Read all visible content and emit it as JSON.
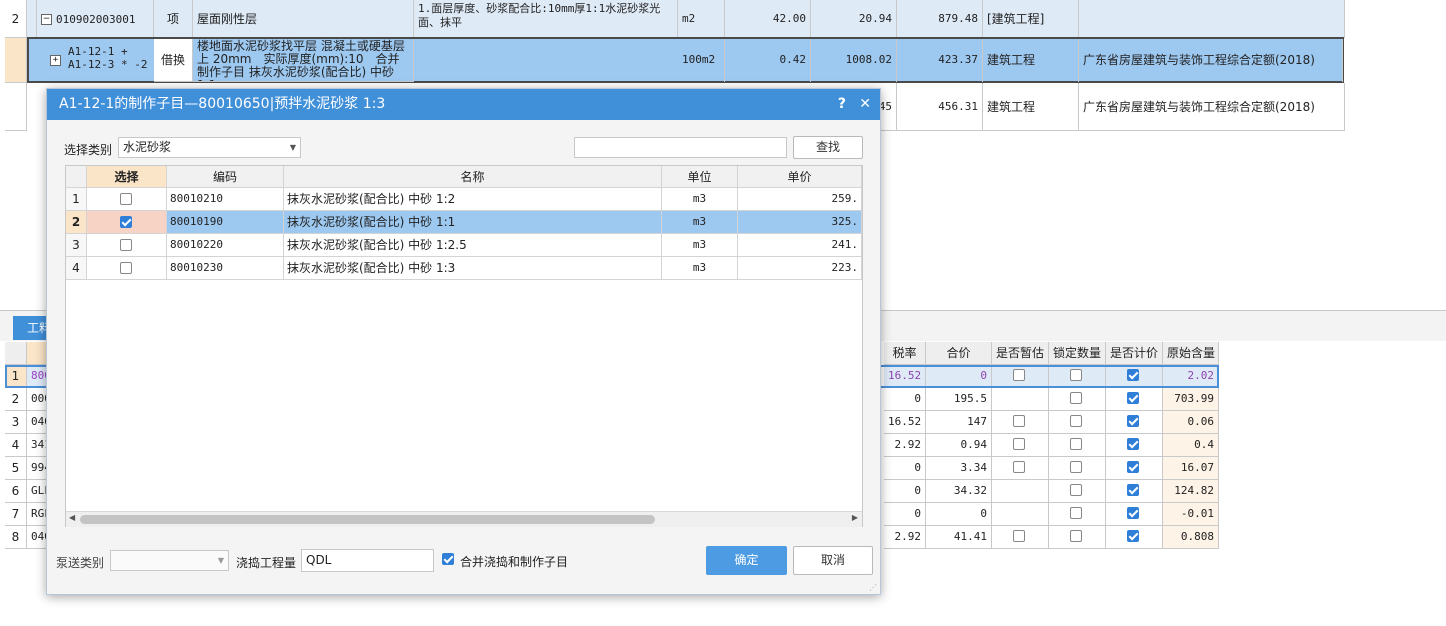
{
  "top_grid": {
    "rows": [
      {
        "index": "2",
        "code": "010902003001",
        "type": "项",
        "name": "屋面刚性层",
        "feature": "1.面层厚度、砂浆配合比:10mm厚1:1水泥砂浆光面、抹平",
        "unit": "m2",
        "qty": "42.00",
        "price": "20.94",
        "total": "879.48",
        "category": "[建筑工程]",
        "standard": ""
      },
      {
        "code_line1": "A1-12-1 +",
        "code_line2": "A1-12-3 * -2",
        "type": "借换",
        "name": "楼地面水泥砂浆找平层 混凝土或硬基层上 20mm　实际厚度(mm):10　合并制作子目 抹灰水泥砂浆(配合比) 中砂 1:1",
        "unit": "100m2",
        "qty": "0.42",
        "price": "1008.02",
        "total": "423.37",
        "category": "建筑工程",
        "standard": "广东省房屋建筑与装饰工程综合定额(2018)"
      },
      {
        "price_tail": "45",
        "total": "456.31",
        "category": "建筑工程",
        "standard": "广东省房屋建筑与装饰工程综合定额(2018)"
      }
    ]
  },
  "bottom_grid": {
    "tab_label": "工料",
    "headers": [
      "税率",
      "合价",
      "是否暂估",
      "锁定数量",
      "是否计价",
      "原始含量"
    ],
    "rows": [
      {
        "index": "1",
        "code": "800",
        "tax": "16.52",
        "total": "0",
        "est": "off",
        "lock": "off",
        "priced": "on",
        "orig": "2.02"
      },
      {
        "index": "2",
        "code": "000",
        "tax": "0",
        "total": "195.5",
        "est": "none",
        "lock": "off",
        "priced": "on",
        "orig": "703.99"
      },
      {
        "index": "3",
        "code": "040",
        "tax": "16.52",
        "total": "147",
        "est": "off",
        "lock": "off",
        "priced": "on",
        "orig": "0.06"
      },
      {
        "index": "4",
        "code": "341",
        "tax": "2.92",
        "total": "0.94",
        "est": "off",
        "lock": "off",
        "priced": "on",
        "orig": "0.4"
      },
      {
        "index": "5",
        "code": "994",
        "tax": "0",
        "total": "3.34",
        "est": "off",
        "lock": "off",
        "priced": "on",
        "orig": "16.07"
      },
      {
        "index": "6",
        "code": "GLF",
        "tax": "0",
        "total": "34.32",
        "est": "none",
        "lock": "off",
        "priced": "on",
        "orig": "124.82"
      },
      {
        "index": "7",
        "code": "RGF",
        "tax": "0",
        "total": "0",
        "est": "none",
        "lock": "off",
        "priced": "on",
        "orig": "-0.01"
      },
      {
        "index": "8",
        "code": "040",
        "tax": "2.92",
        "total": "41.41",
        "est": "off",
        "lock": "off",
        "priced": "on",
        "orig": "0.808"
      }
    ]
  },
  "dialog": {
    "title": "A1-12-1的制作子目—80010650|预拌水泥砂浆 1:3",
    "help_label": "?",
    "close_label": "✕",
    "category_label": "选择类别",
    "category_value": "水泥砂浆",
    "search_value": "",
    "find_label": "查找",
    "headers": {
      "select": "选择",
      "code": "编码",
      "name": "名称",
      "unit": "单位",
      "price": "单价"
    },
    "rows": [
      {
        "index": "1",
        "checked": false,
        "code": "80010210",
        "name": "抹灰水泥砂浆(配合比) 中砂 1:2",
        "unit": "m3",
        "price": "259."
      },
      {
        "index": "2",
        "checked": true,
        "code": "80010190",
        "name": "抹灰水泥砂浆(配合比) 中砂 1:1",
        "unit": "m3",
        "price": "325."
      },
      {
        "index": "3",
        "checked": false,
        "code": "80010220",
        "name": "抹灰水泥砂浆(配合比) 中砂 1:2.5",
        "unit": "m3",
        "price": "241."
      },
      {
        "index": "4",
        "checked": false,
        "code": "80010230",
        "name": "抹灰水泥砂浆(配合比) 中砂 1:3",
        "unit": "m3",
        "price": "223."
      }
    ],
    "pump_label": "泵送类别",
    "pump_value": "",
    "pour_label": "浇捣工程量",
    "pour_value": "QDL",
    "merge_label": "合并浇捣和制作子目",
    "merge_checked": true,
    "ok_label": "确定",
    "cancel_label": "取消"
  },
  "colors": {
    "accent": "#3f8fd9",
    "selected_row": "#9dc8f0",
    "highlight_cell": "#f7d3c6",
    "header_select": "#fbe5c8"
  }
}
